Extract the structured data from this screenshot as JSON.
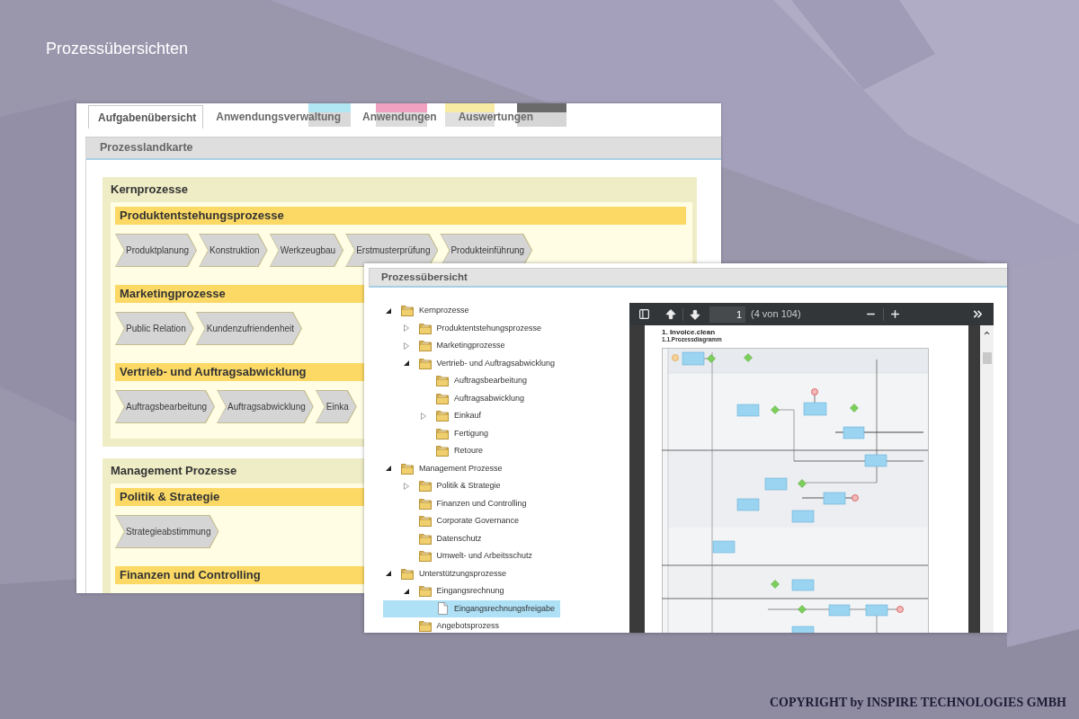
{
  "slide": {
    "title": "Prozessübersichten",
    "footer": "COPYRIGHT by INSPIRE TECHNOLOGIES GMBH"
  },
  "process_map_window": {
    "tabs": [
      {
        "label": "Aufgabenübersicht",
        "selected": true
      },
      {
        "label": "Anwendungsverwaltung",
        "selected": false
      },
      {
        "label": "Anwendungen",
        "selected": false
      },
      {
        "label": "Auswertungen",
        "selected": false
      }
    ],
    "header": "Prozesslandkarte",
    "groups": [
      {
        "title": "Kernprozesse",
        "sections": [
          {
            "title": "Produktentstehungsprozesse",
            "steps": [
              "Produktplanung",
              "Konstruktion",
              "Werkzeugbau",
              "Erstmusterprüfung",
              "Produkteinführung"
            ]
          },
          {
            "title": "Marketingprozesse",
            "steps": [
              "Public Relation",
              "Kundenzufriendenheit"
            ]
          },
          {
            "title": "Vertrieb- und Auftragsabwicklung",
            "steps": [
              "Auftragsbearbeitung",
              "Auftragsabwicklung",
              "Einka"
            ]
          }
        ]
      },
      {
        "title": "Management Prozesse",
        "sections": [
          {
            "title": "Politik & Strategie",
            "steps": [
              "Strategieabstimmung"
            ]
          },
          {
            "title": "Finanzen und Controlling"
          }
        ]
      }
    ]
  },
  "process_tree_window": {
    "header": "Prozessübersicht",
    "tree": [
      {
        "label": "Kernprozesse",
        "kind": "folder",
        "expanded": true,
        "selected": false,
        "children": [
          {
            "label": "Produktentstehungsprozesse",
            "kind": "folder",
            "expanded": false,
            "selected": false
          },
          {
            "label": "Marketingprozesse",
            "kind": "folder",
            "expanded": false,
            "selected": false
          },
          {
            "label": "Vertrieb- und Auftragsabwicklung",
            "kind": "folder",
            "expanded": true,
            "selected": false,
            "children": [
              {
                "label": "Auftragsbearbeitung",
                "kind": "folder",
                "selected": false
              },
              {
                "label": "Auftragsabwicklung",
                "kind": "folder",
                "selected": false
              },
              {
                "label": "Einkauf",
                "kind": "folder",
                "expanded": false,
                "selected": false
              },
              {
                "label": "Fertigung",
                "kind": "folder",
                "selected": false
              },
              {
                "label": "Retoure",
                "kind": "folder",
                "selected": false
              }
            ]
          }
        ]
      },
      {
        "label": "Management Prozesse",
        "kind": "folder",
        "expanded": true,
        "selected": false,
        "children": [
          {
            "label": "Politik & Strategie",
            "kind": "folder",
            "expanded": false,
            "selected": false
          },
          {
            "label": "Finanzen und Controlling",
            "kind": "folder",
            "selected": false
          },
          {
            "label": "Corporate Governance",
            "kind": "folder",
            "selected": false
          },
          {
            "label": "Datenschutz",
            "kind": "folder",
            "selected": false
          },
          {
            "label": "Umwelt- und Arbeitsschutz",
            "kind": "folder",
            "selected": false
          }
        ]
      },
      {
        "label": "Unterstützungsprozesse",
        "kind": "folder",
        "expanded": true,
        "selected": false,
        "children": [
          {
            "label": "Eingangsrechnung",
            "kind": "folder",
            "expanded": true,
            "selected": false,
            "children": [
              {
                "label": "Eingangsrechnungsfreigabe",
                "kind": "document",
                "selected": true
              }
            ]
          },
          {
            "label": "Angebotsprozess",
            "kind": "folder",
            "selected": false
          }
        ]
      }
    ],
    "pdf_viewer": {
      "page_number": "1",
      "page_info": "(4 von 104)",
      "page": {
        "title": "1. Invoice.clean",
        "subtitle": "1.1.Prozessdiagramm"
      }
    }
  }
}
